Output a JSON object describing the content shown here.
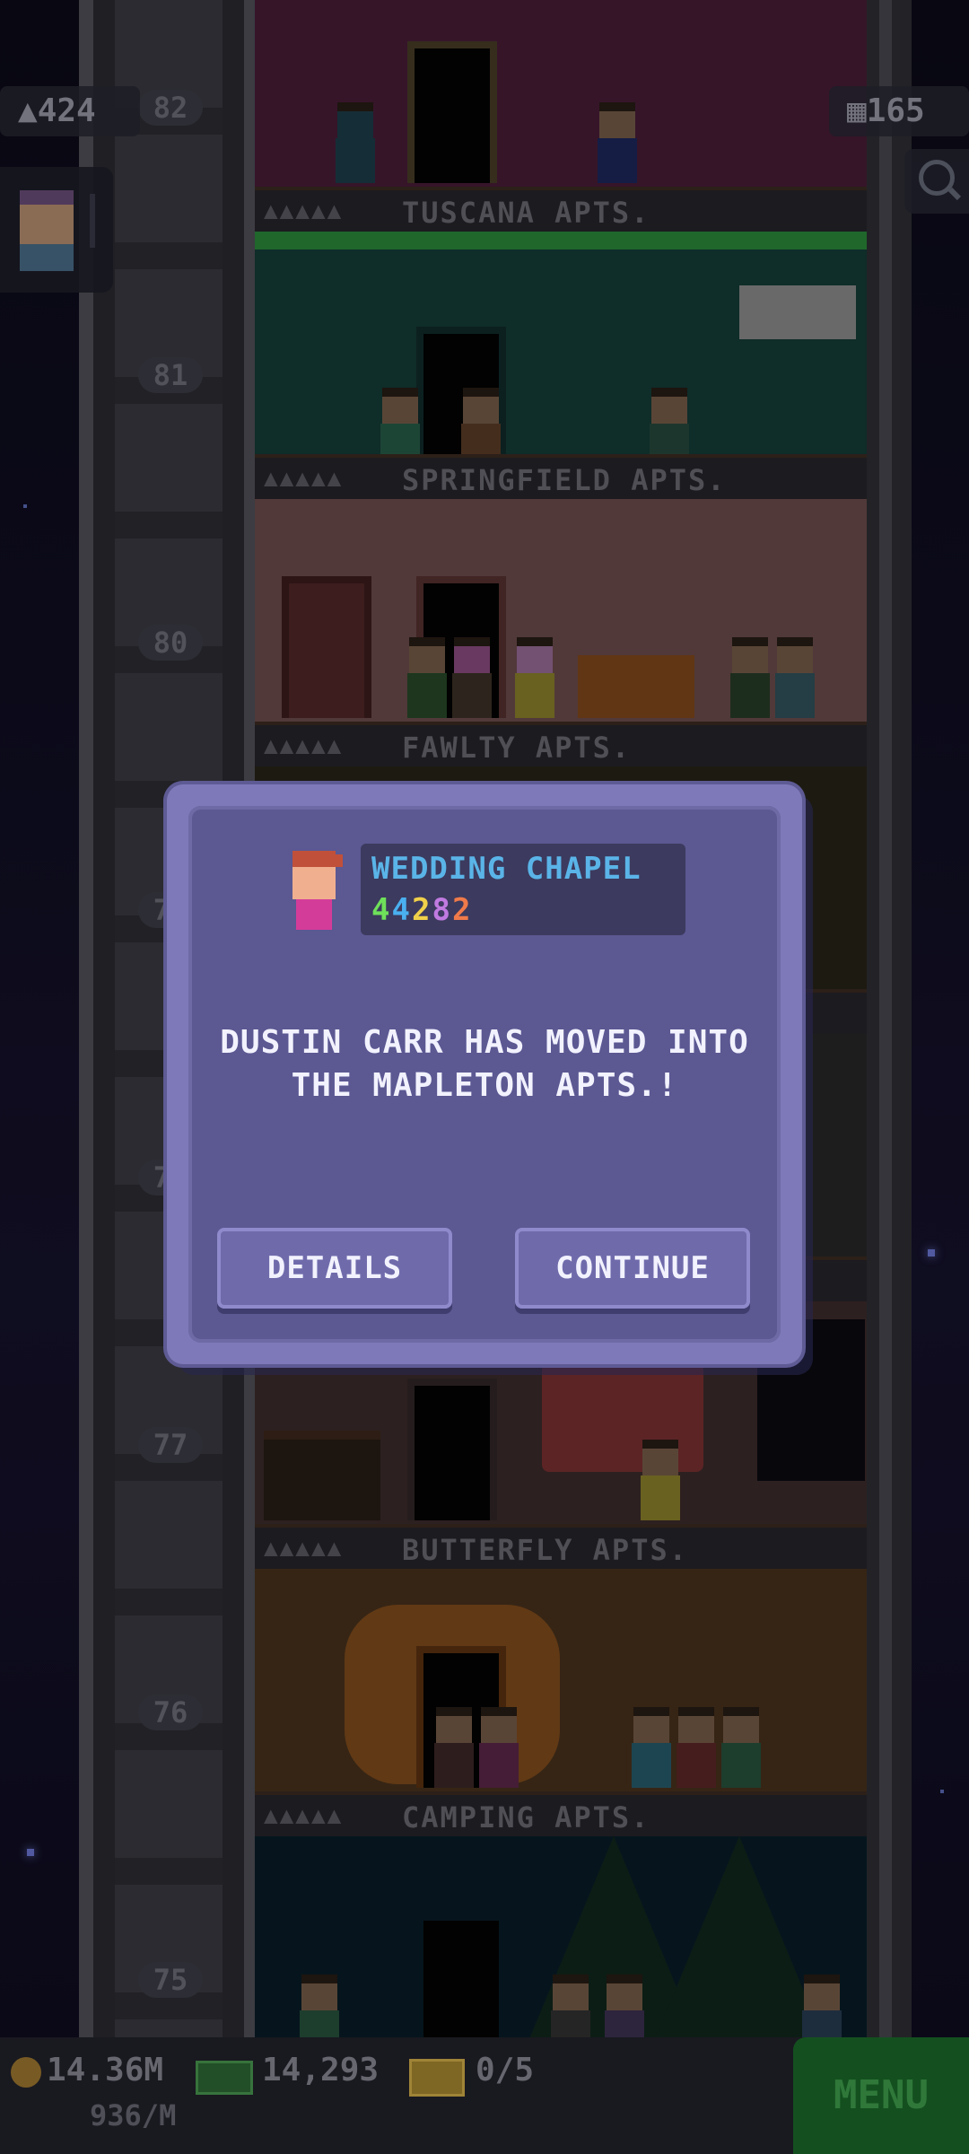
{
  "hud": {
    "population": "424",
    "floors": "165"
  },
  "floors": [
    {
      "number": "82",
      "name": "TUSCANA APTS.",
      "stars": "▲▲▲▲▲",
      "wall": "#6a2a52"
    },
    {
      "number": "81",
      "name": "SPRINGFIELD APTS.",
      "stars": "▲▲▲▲▲",
      "wall": "#1e5a52"
    },
    {
      "number": "80",
      "name": "FAWLTY APTS.",
      "stars": "▲▲▲▲▲",
      "wall": "#a07070"
    },
    {
      "number": "79",
      "name": "",
      "stars": "",
      "wall": "#3a3424"
    },
    {
      "number": "78",
      "name": "",
      "stars": "",
      "wall": "#3a3a3a"
    },
    {
      "number": "77",
      "name": "BUTTERFLY APTS.",
      "stars": "▲▲▲▲▲",
      "wall": "#5a4040"
    },
    {
      "number": "76",
      "name": "CAMPING APTS.",
      "stars": "▲▲▲▲▲",
      "wall": "#6a4a2a"
    },
    {
      "number": "75",
      "name": "",
      "stars": "",
      "wall": "#0e2a3a"
    }
  ],
  "dialog": {
    "business_name": "WEDDING CHAPEL",
    "code_digits": [
      "4",
      "4",
      "2",
      "8",
      "2"
    ],
    "code_colors": [
      "#6ee05a",
      "#4ab0f0",
      "#f0d04a",
      "#c07ae0",
      "#f07a4a"
    ],
    "message": "DUSTIN CARR HAS MOVED INTO THE MAPLETON APTS.!",
    "details_label": "DETAILS",
    "continue_label": "CONTINUE"
  },
  "bottom": {
    "coins": "14.36M",
    "coin_rate": "936/M",
    "bux": "14,293",
    "tickets": "0/5",
    "menu_label": "MENU"
  }
}
